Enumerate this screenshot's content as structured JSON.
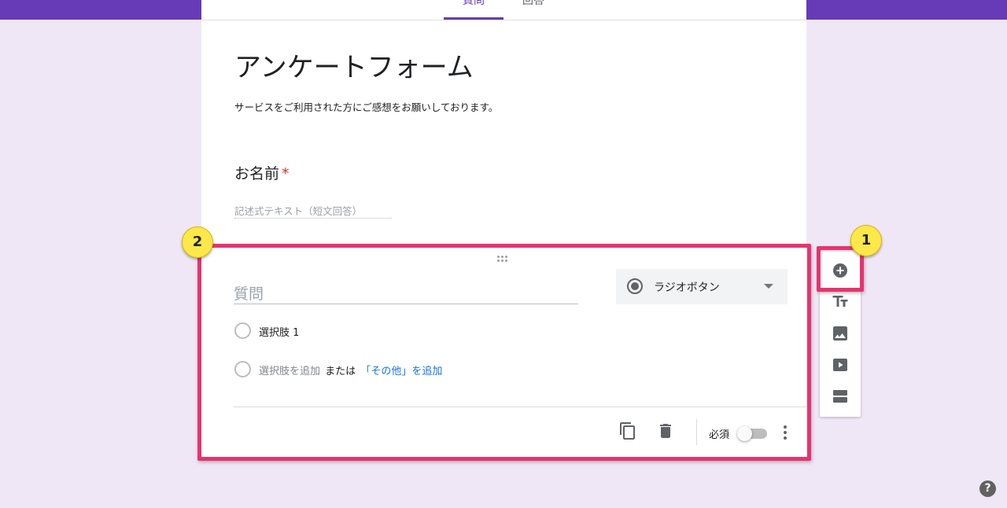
{
  "tabs": [
    {
      "label": "質問"
    },
    {
      "label": "回答"
    }
  ],
  "form": {
    "title": "アンケートフォーム",
    "description": "サービスをご利用された方にご感想をお願いしております。"
  },
  "question1": {
    "title": "お名前",
    "required_mark": "*",
    "placeholder": "記述式テキスト（短文回答）"
  },
  "editor": {
    "question_placeholder": "質問",
    "type_label": "ラジオボタン",
    "option1": "選択肢 1",
    "add_option": "選択肢を追加",
    "or_text": "または",
    "add_other": "「その他」を追加",
    "required_label": "必須"
  },
  "colors": {
    "accent": "#673ab7",
    "highlight": "#e8336e",
    "badge": "#fde84a",
    "link": "#1a73e8"
  },
  "badges": {
    "one": "1",
    "two": "2"
  },
  "toolbar": {
    "items": [
      "add-question-icon",
      "add-title-icon",
      "add-image-icon",
      "add-video-icon",
      "add-section-icon"
    ]
  },
  "help": {
    "label": "?"
  }
}
